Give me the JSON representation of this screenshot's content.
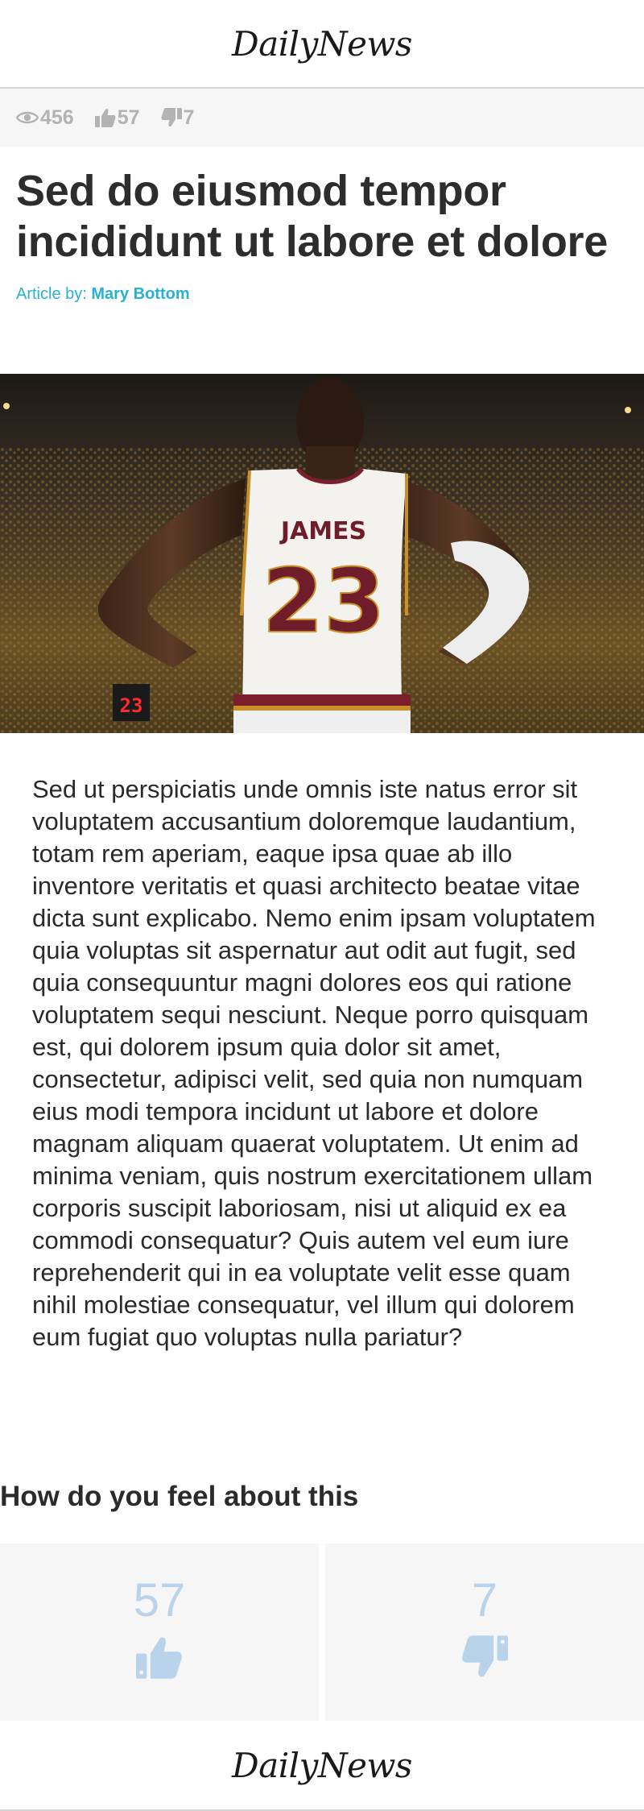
{
  "header": {
    "logo": "DailyNews"
  },
  "stats": {
    "views": "456",
    "likes": "57",
    "dislikes": "7"
  },
  "article": {
    "title": "Sed do eiusmod tempor incididunt ut labore et dolore",
    "byline_prefix": "Article by:",
    "author": "Mary Bottom",
    "hero": {
      "jersey_name": "JAMES",
      "jersey_number": "23",
      "shot_clock": "23"
    },
    "body": "Sed ut perspiciatis unde omnis iste natus error sit voluptatem accusantium doloremque laudantium, totam rem aperiam, eaque ipsa quae ab illo inventore veritatis et quasi architecto beatae vitae dicta sunt explicabo. Nemo enim ipsam voluptatem quia voluptas sit aspernatur aut odit aut fugit, sed quia consequuntur magni dolores eos qui ratione voluptatem sequi nesciunt. Neque porro quisquam est, qui dolorem ipsum quia dolor sit amet, consectetur, adipisci velit, sed quia non numquam eius modi tempora incidunt ut labore et dolore magnam aliquam quaerat voluptatem. Ut enim ad minima veniam, quis nostrum exercitationem ullam corporis suscipit laboriosam, nisi ut aliquid ex ea commodi consequatur? Quis autem vel eum iure reprehenderit qui in ea voluptate velit esse quam nihil molestiae consequatur, vel illum qui dolorem eum fugiat quo voluptas nulla pariatur?"
  },
  "feedback": {
    "heading": "How do you feel about this",
    "like_count": "57",
    "dislike_count": "7"
  },
  "footer": {
    "logo": "DailyNews"
  },
  "colors": {
    "accent": "#27b2d2",
    "vote": "#b9d3ea",
    "stat": "#b3b3b3",
    "panel": "#f6f6f6"
  },
  "icons": [
    "eye-icon",
    "thumbs-up-icon",
    "thumbs-down-icon"
  ]
}
